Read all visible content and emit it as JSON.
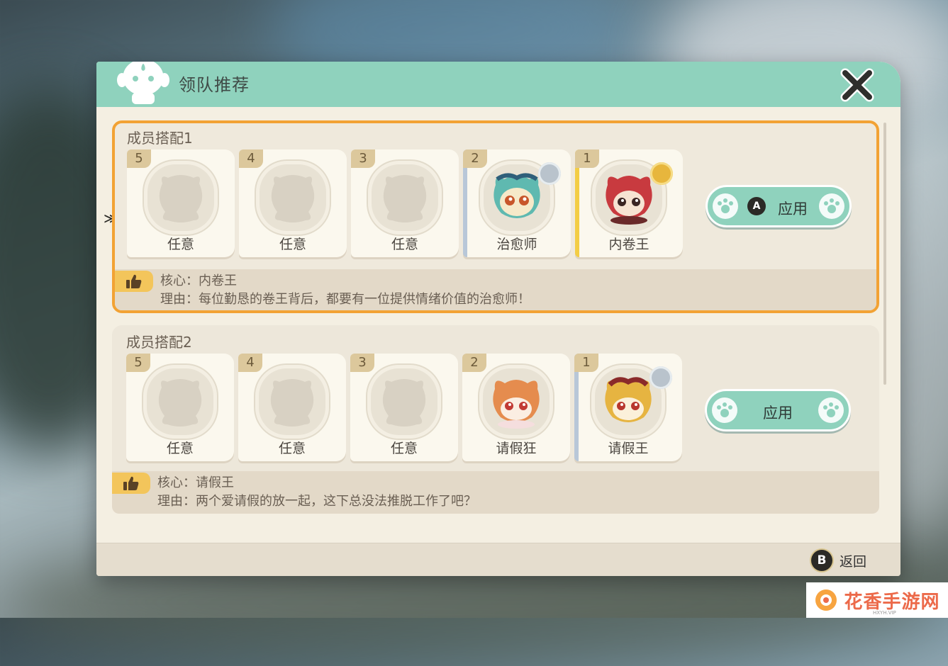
{
  "window": {
    "title": "领队推荐"
  },
  "footer": {
    "back_key": "B",
    "back_label": "返回"
  },
  "selector_glyph": "≫",
  "groups": [
    {
      "title": "成员搭配1",
      "selected": true,
      "slots": [
        {
          "num": "5",
          "label": "任意",
          "filled": false
        },
        {
          "num": "4",
          "label": "任意",
          "filled": false
        },
        {
          "num": "3",
          "label": "任意",
          "filled": false
        },
        {
          "num": "2",
          "label": "治愈师",
          "filled": true,
          "badge": "silver"
        },
        {
          "num": "1",
          "label": "内卷王",
          "filled": true,
          "badge": "gold"
        }
      ],
      "apply": {
        "key": "A",
        "label": "应用"
      },
      "core": "核心：内卷王",
      "reason": "理由：每位勤恳的卷王背后，都要有一位提供情绪价值的治愈师！"
    },
    {
      "title": "成员搭配2",
      "selected": false,
      "slots": [
        {
          "num": "5",
          "label": "任意",
          "filled": false
        },
        {
          "num": "4",
          "label": "任意",
          "filled": false
        },
        {
          "num": "3",
          "label": "任意",
          "filled": false
        },
        {
          "num": "2",
          "label": "请假狂",
          "filled": true
        },
        {
          "num": "1",
          "label": "请假王",
          "filled": true,
          "badge": "silver"
        }
      ],
      "apply": {
        "label": "应用"
      },
      "core": "核心：请假王",
      "reason": "理由：两个爱请假的放一起，这下总没法推脱工作了吧？"
    }
  ],
  "watermark": {
    "text": "花香手游网",
    "sub": "HXYH.VIP"
  },
  "colors": {
    "header": "#8fd2bd",
    "selection": "#f2a234",
    "panel": "#f4efe2",
    "thumb": "#f3c55b"
  }
}
